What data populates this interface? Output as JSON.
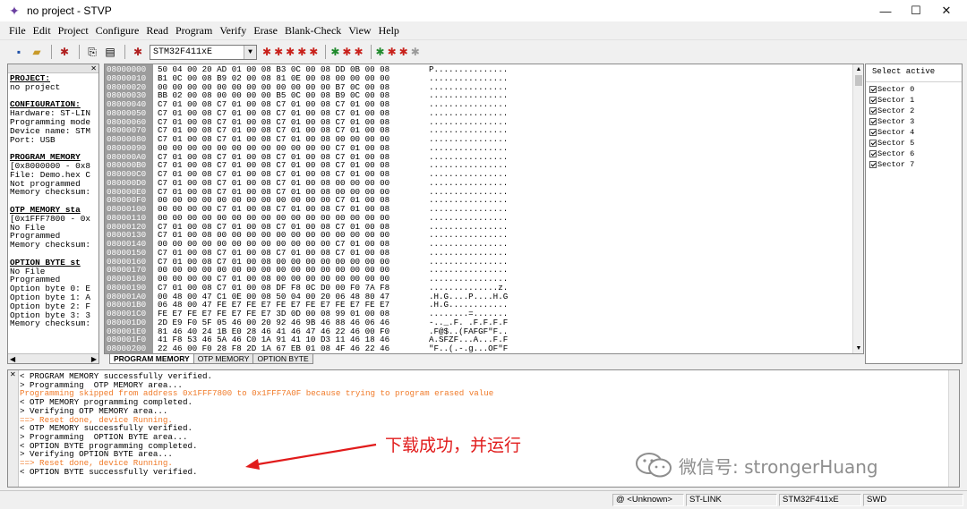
{
  "window": {
    "title": "no project - STVP",
    "controls": {
      "minimize": "—",
      "maximize": "☐",
      "close": "✕"
    }
  },
  "menu": [
    "File",
    "Edit",
    "Project",
    "Configure",
    "Read",
    "Program",
    "Verify",
    "Erase",
    "Blank-Check",
    "View",
    "Help"
  ],
  "toolbar": {
    "device": "STM32F411xE",
    "icons": [
      "save-icon",
      "open-icon",
      "read-all-icon",
      "copy-icon",
      "paste-icon",
      "connect-icon"
    ]
  },
  "left_panel": {
    "lines": [
      {
        "text": "PROJECT:",
        "heading": true
      },
      {
        "text": "no project",
        "heading": false
      },
      {
        "text": "",
        "heading": false
      },
      {
        "text": "CONFIGURATION:",
        "heading": true
      },
      {
        "text": "Hardware: ST-LIN",
        "heading": false
      },
      {
        "text": "Programming mode",
        "heading": false
      },
      {
        "text": "Device name: STM",
        "heading": false
      },
      {
        "text": "Port: USB",
        "heading": false
      },
      {
        "text": "",
        "heading": false
      },
      {
        "text": "PROGRAM MEMORY",
        "heading": true
      },
      {
        "text": "[0x8000000 - 0x8",
        "heading": false
      },
      {
        "text": "File: Demo.hex C",
        "heading": false
      },
      {
        "text": "Not programmed",
        "heading": false
      },
      {
        "text": "Memory checksum:",
        "heading": false
      },
      {
        "text": "",
        "heading": false
      },
      {
        "text": "OTP MEMORY sta",
        "heading": true
      },
      {
        "text": "[0x1FFF7800 - 0x",
        "heading": false
      },
      {
        "text": "No File",
        "heading": false
      },
      {
        "text": "Programmed",
        "heading": false
      },
      {
        "text": "Memory checksum:",
        "heading": false
      },
      {
        "text": "",
        "heading": false
      },
      {
        "text": "OPTION BYTE st",
        "heading": true
      },
      {
        "text": "No File",
        "heading": false
      },
      {
        "text": "Programmed",
        "heading": false
      },
      {
        "text": "Option byte 0: E",
        "heading": false
      },
      {
        "text": "Option byte 1: A",
        "heading": false
      },
      {
        "text": "Option byte 2: F",
        "heading": false
      },
      {
        "text": "Option byte 3: 3",
        "heading": false
      },
      {
        "text": "Memory checksum:",
        "heading": false
      }
    ]
  },
  "hex_rows": [
    {
      "addr": "08000000",
      "bytes": "50 04 00 20 AD 01 00 08 B3 0C 00 08 DD 0B 00 08",
      "ascii": "P..............."
    },
    {
      "addr": "08000010",
      "bytes": "B1 0C 00 08 B9 02 00 08 81 0E 00 08 00 00 00 00",
      "ascii": "................"
    },
    {
      "addr": "08000020",
      "bytes": "00 00 00 00 00 00 00 00 00 00 00 00 B7 0C 00 08",
      "ascii": "................"
    },
    {
      "addr": "08000030",
      "bytes": "BB 02 00 08 00 00 00 00 B5 0C 00 08 B9 0C 00 08",
      "ascii": "................"
    },
    {
      "addr": "08000040",
      "bytes": "C7 01 00 08 C7 01 00 08 C7 01 00 08 C7 01 00 08",
      "ascii": "................"
    },
    {
      "addr": "08000050",
      "bytes": "C7 01 00 08 C7 01 00 08 C7 01 00 08 C7 01 00 08",
      "ascii": "................"
    },
    {
      "addr": "08000060",
      "bytes": "C7 01 00 08 C7 01 00 08 C7 01 00 08 C7 01 00 08",
      "ascii": "................"
    },
    {
      "addr": "08000070",
      "bytes": "C7 01 00 08 C7 01 00 08 C7 01 00 08 C7 01 00 08",
      "ascii": "................"
    },
    {
      "addr": "08000080",
      "bytes": "C7 01 00 08 C7 01 00 08 C7 01 00 08 00 00 00 00",
      "ascii": "................"
    },
    {
      "addr": "08000090",
      "bytes": "00 00 00 00 00 00 00 00 00 00 00 00 C7 01 00 08",
      "ascii": "................"
    },
    {
      "addr": "080000A0",
      "bytes": "C7 01 00 08 C7 01 00 08 C7 01 00 08 C7 01 00 08",
      "ascii": "................"
    },
    {
      "addr": "080000B0",
      "bytes": "C7 01 00 08 C7 01 00 08 C7 01 00 08 C7 01 00 08",
      "ascii": "................"
    },
    {
      "addr": "080000C0",
      "bytes": "C7 01 00 08 C7 01 00 08 C7 01 00 08 C7 01 00 08",
      "ascii": "................"
    },
    {
      "addr": "080000D0",
      "bytes": "C7 01 00 08 C7 01 00 08 C7 01 00 08 00 00 00 00",
      "ascii": "................"
    },
    {
      "addr": "080000E0",
      "bytes": "C7 01 00 08 C7 01 00 08 C7 01 00 08 00 00 00 00",
      "ascii": "................"
    },
    {
      "addr": "080000F0",
      "bytes": "00 00 00 00 00 00 00 00 00 00 00 00 C7 01 00 08",
      "ascii": "................"
    },
    {
      "addr": "08000100",
      "bytes": "00 00 00 00 C7 01 00 08 C7 01 00 08 C7 01 00 08",
      "ascii": "................"
    },
    {
      "addr": "08000110",
      "bytes": "00 00 00 00 00 00 00 00 00 00 00 00 00 00 00 00",
      "ascii": "................"
    },
    {
      "addr": "08000120",
      "bytes": "C7 01 00 08 C7 01 00 08 C7 01 00 08 C7 01 00 08",
      "ascii": "................"
    },
    {
      "addr": "08000130",
      "bytes": "C7 01 00 08 00 00 00 00 00 00 00 00 00 00 00 00",
      "ascii": "................"
    },
    {
      "addr": "08000140",
      "bytes": "00 00 00 00 00 00 00 00 00 00 00 00 C7 01 00 08",
      "ascii": "................"
    },
    {
      "addr": "08000150",
      "bytes": "C7 01 00 08 C7 01 00 08 C7 01 00 08 C7 01 00 08",
      "ascii": "................"
    },
    {
      "addr": "08000160",
      "bytes": "C7 01 00 08 C7 01 00 08 00 00 00 00 00 00 00 00",
      "ascii": "................"
    },
    {
      "addr": "08000170",
      "bytes": "00 00 00 00 00 00 00 00 00 00 00 00 00 00 00 00",
      "ascii": "................"
    },
    {
      "addr": "08000180",
      "bytes": "00 00 00 00 C7 01 00 08 00 00 00 00 00 00 00 00",
      "ascii": "................"
    },
    {
      "addr": "08000190",
      "bytes": "C7 01 00 08 C7 01 00 08 DF F8 0C D0 00 F0 7A F8",
      "ascii": "..............z."
    },
    {
      "addr": "080001A0",
      "bytes": "00 48 00 47 C1 0E 00 08 50 04 00 20 06 48 80 47",
      "ascii": ".H.G....P....H.G"
    },
    {
      "addr": "080001B0",
      "bytes": "06 48 00 47 FE E7 FE E7 FE E7 FE E7 FE E7 FE E7",
      "ascii": ".H.G............"
    },
    {
      "addr": "080001C0",
      "bytes": "FE E7 FE E7 FE E7 FE E7 3D 0D 00 08 99 01 00 08",
      "ascii": "........=......."
    },
    {
      "addr": "080001D0",
      "bytes": "2D E9 F0 5F 05 46 00 20 92 46 9B 46 88 46 06 46",
      "ascii": "-.._.F. .F.F.F.F"
    },
    {
      "addr": "080001E0",
      "bytes": "81 46 40 24 1B E0 28 46 41 46 47 46 22 46 00 F0",
      "ascii": ".F@$..(FAFGF\"F.."
    },
    {
      "addr": "080001F0",
      "bytes": "41 F8 53 46 5A 46 C0 1A 91 41 10 D3 11 46 18 46",
      "ascii": "A.SFZF...A...F.F"
    },
    {
      "addr": "08000200",
      "bytes": "22 46 00 F0 28 F8 2D 1A 67 EB 01 08 4F 46 22 46",
      "ascii": "\"F..(.-.g...OF\"F"
    }
  ],
  "tabs": [
    "PROGRAM MEMORY",
    "OTP MEMORY",
    "OPTION BYTE"
  ],
  "sectors": {
    "title": "Select active",
    "items": [
      "Sector 0",
      "Sector 1",
      "Sector 2",
      "Sector 3",
      "Sector 4",
      "Sector 5",
      "Sector 6",
      "Sector 7"
    ]
  },
  "log": [
    {
      "text": "< PROGRAM MEMORY successfully verified.",
      "color": "black"
    },
    {
      "text": "> Programming  OTP MEMORY area...",
      "color": "black"
    },
    {
      "text": "Programming skipped from address 0x1FFF7800 to 0x1FFF7A0F because trying to program erased value",
      "color": "orange"
    },
    {
      "text": "< OTP MEMORY programming completed.",
      "color": "black"
    },
    {
      "text": "> Verifying OTP MEMORY area...",
      "color": "black"
    },
    {
      "text": "==> Reset done, device Running.",
      "color": "orange"
    },
    {
      "text": "< OTP MEMORY successfully verified.",
      "color": "black"
    },
    {
      "text": "> Programming  OPTION BYTE area...",
      "color": "black"
    },
    {
      "text": "< OPTION BYTE programming completed.",
      "color": "black"
    },
    {
      "text": "> Verifying OPTION BYTE area...",
      "color": "black"
    },
    {
      "text": "==> Reset done, device Running.",
      "color": "orange"
    },
    {
      "text": "< OPTION BYTE successfully verified.",
      "color": "black"
    }
  ],
  "annotation": {
    "text": "下载成功，并运行",
    "color": "#e11b1b"
  },
  "watermark": {
    "text": "微信号: strongerHuang"
  },
  "statusbar": [
    "@ <Unknown>",
    "ST-LINK",
    "STM32F411xE",
    "SWD"
  ],
  "colors": {
    "orange_log": "#f07b2a",
    "address_column": "#9c9c9c"
  }
}
